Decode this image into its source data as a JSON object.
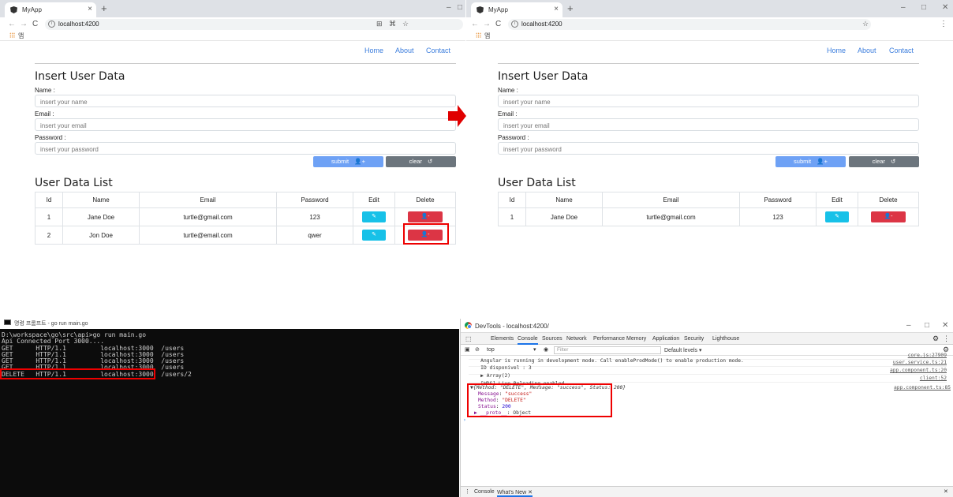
{
  "browser": {
    "tab_title": "MyApp",
    "tab_close": "×",
    "new_tab": "+",
    "url": "localhost:4200",
    "info_symbol": "i",
    "nav": {
      "back": "←",
      "forward": "→",
      "reload": "C",
      "menu": "⋮"
    },
    "bookmark_item": "앱",
    "window_controls": {
      "minimize": "–",
      "maximize": "□",
      "close": "✕"
    },
    "extensions_left": [
      "⊞",
      "⌘",
      "☆",
      "⋮"
    ]
  },
  "app": {
    "nav_links": [
      "Home",
      "About",
      "Contact"
    ],
    "form_title": "Insert User Data",
    "fields": [
      {
        "label": "Name :",
        "placeholder": "insert your name"
      },
      {
        "label": "Email :",
        "placeholder": "insert your email"
      },
      {
        "label": "Password :",
        "placeholder": "insert your password"
      }
    ],
    "submit_label": "submit",
    "clear_label": "clear",
    "submit_icon": "👤+",
    "clear_icon": "↺",
    "list_title": "User Data List",
    "table_headers": [
      "Id",
      "Name",
      "Email",
      "Password",
      "Edit",
      "Delete"
    ],
    "edit_icon": "✎",
    "delete_icon": "👤-"
  },
  "before": {
    "users": [
      {
        "id": "1",
        "name": "Jane Doe",
        "email": "turtle@gmail.com",
        "password": "123"
      },
      {
        "id": "2",
        "name": "Jon Doe",
        "email": "turtle@email.com",
        "password": "qwer"
      }
    ]
  },
  "after": {
    "users": [
      {
        "id": "1",
        "name": "Jane Doe",
        "email": "turtle@gmail.com",
        "password": "123"
      }
    ]
  },
  "terminal": {
    "title": "명령 프롬프트 - go  run main.go",
    "lines": [
      "D:\\workspace\\go\\src\\api>go run main.go",
      "Api Connected Port 3000....",
      "GET      HTTP/1.1         localhost:3000  /users",
      "GET      HTTP/1.1         localhost:3000  /users",
      "GET      HTTP/1.1         localhost:3000  /users",
      "GET      HTTP/1.1         localhost:3000  /users",
      "DELETE   HTTP/1.1         localhost:3000  /users/2"
    ]
  },
  "devtools": {
    "title": "DevTools - localhost:4200/",
    "tabs": [
      "Elements",
      "Console",
      "Sources",
      "Network",
      "Performance",
      "Memory",
      "Application",
      "Security",
      "Lighthouse"
    ],
    "active_tab": "Console",
    "context": "top",
    "filter_placeholder": "Filter",
    "levels": "Default levels ▾",
    "messages": [
      {
        "text": "Angular is running in development mode. Call enableProdMode() to enable production mode.",
        "source": "core.js:27909"
      },
      {
        "text": "ID disponivel : 3",
        "source": "user.service.ts:21"
      },
      {
        "text": "▶ Array(2)",
        "source": "app.component.ts:20"
      },
      {
        "text": "[WDS] Live Reloading enabled.",
        "source": "client:52"
      }
    ],
    "object_summary": "▼{Method: \"DELETE\", Message: \"success\", Status: 200}",
    "object_source": "app.component.ts:85",
    "object_props": [
      {
        "key": "Message",
        "value": "\"success\""
      },
      {
        "key": "Method",
        "value": "\"DELETE\""
      },
      {
        "key": "Status",
        "value": "200"
      },
      {
        "key": "▶ __proto__",
        "value": "Object"
      }
    ],
    "prompt": "›",
    "drawer_tabs": [
      "Console",
      "What's New ✕"
    ]
  },
  "colors": {
    "link": "#3b7ddd",
    "submit": "#6ea1f5",
    "clear": "#6c757d",
    "edit": "#17c1e8",
    "delete": "#dc3545",
    "highlight": "#e00000"
  }
}
